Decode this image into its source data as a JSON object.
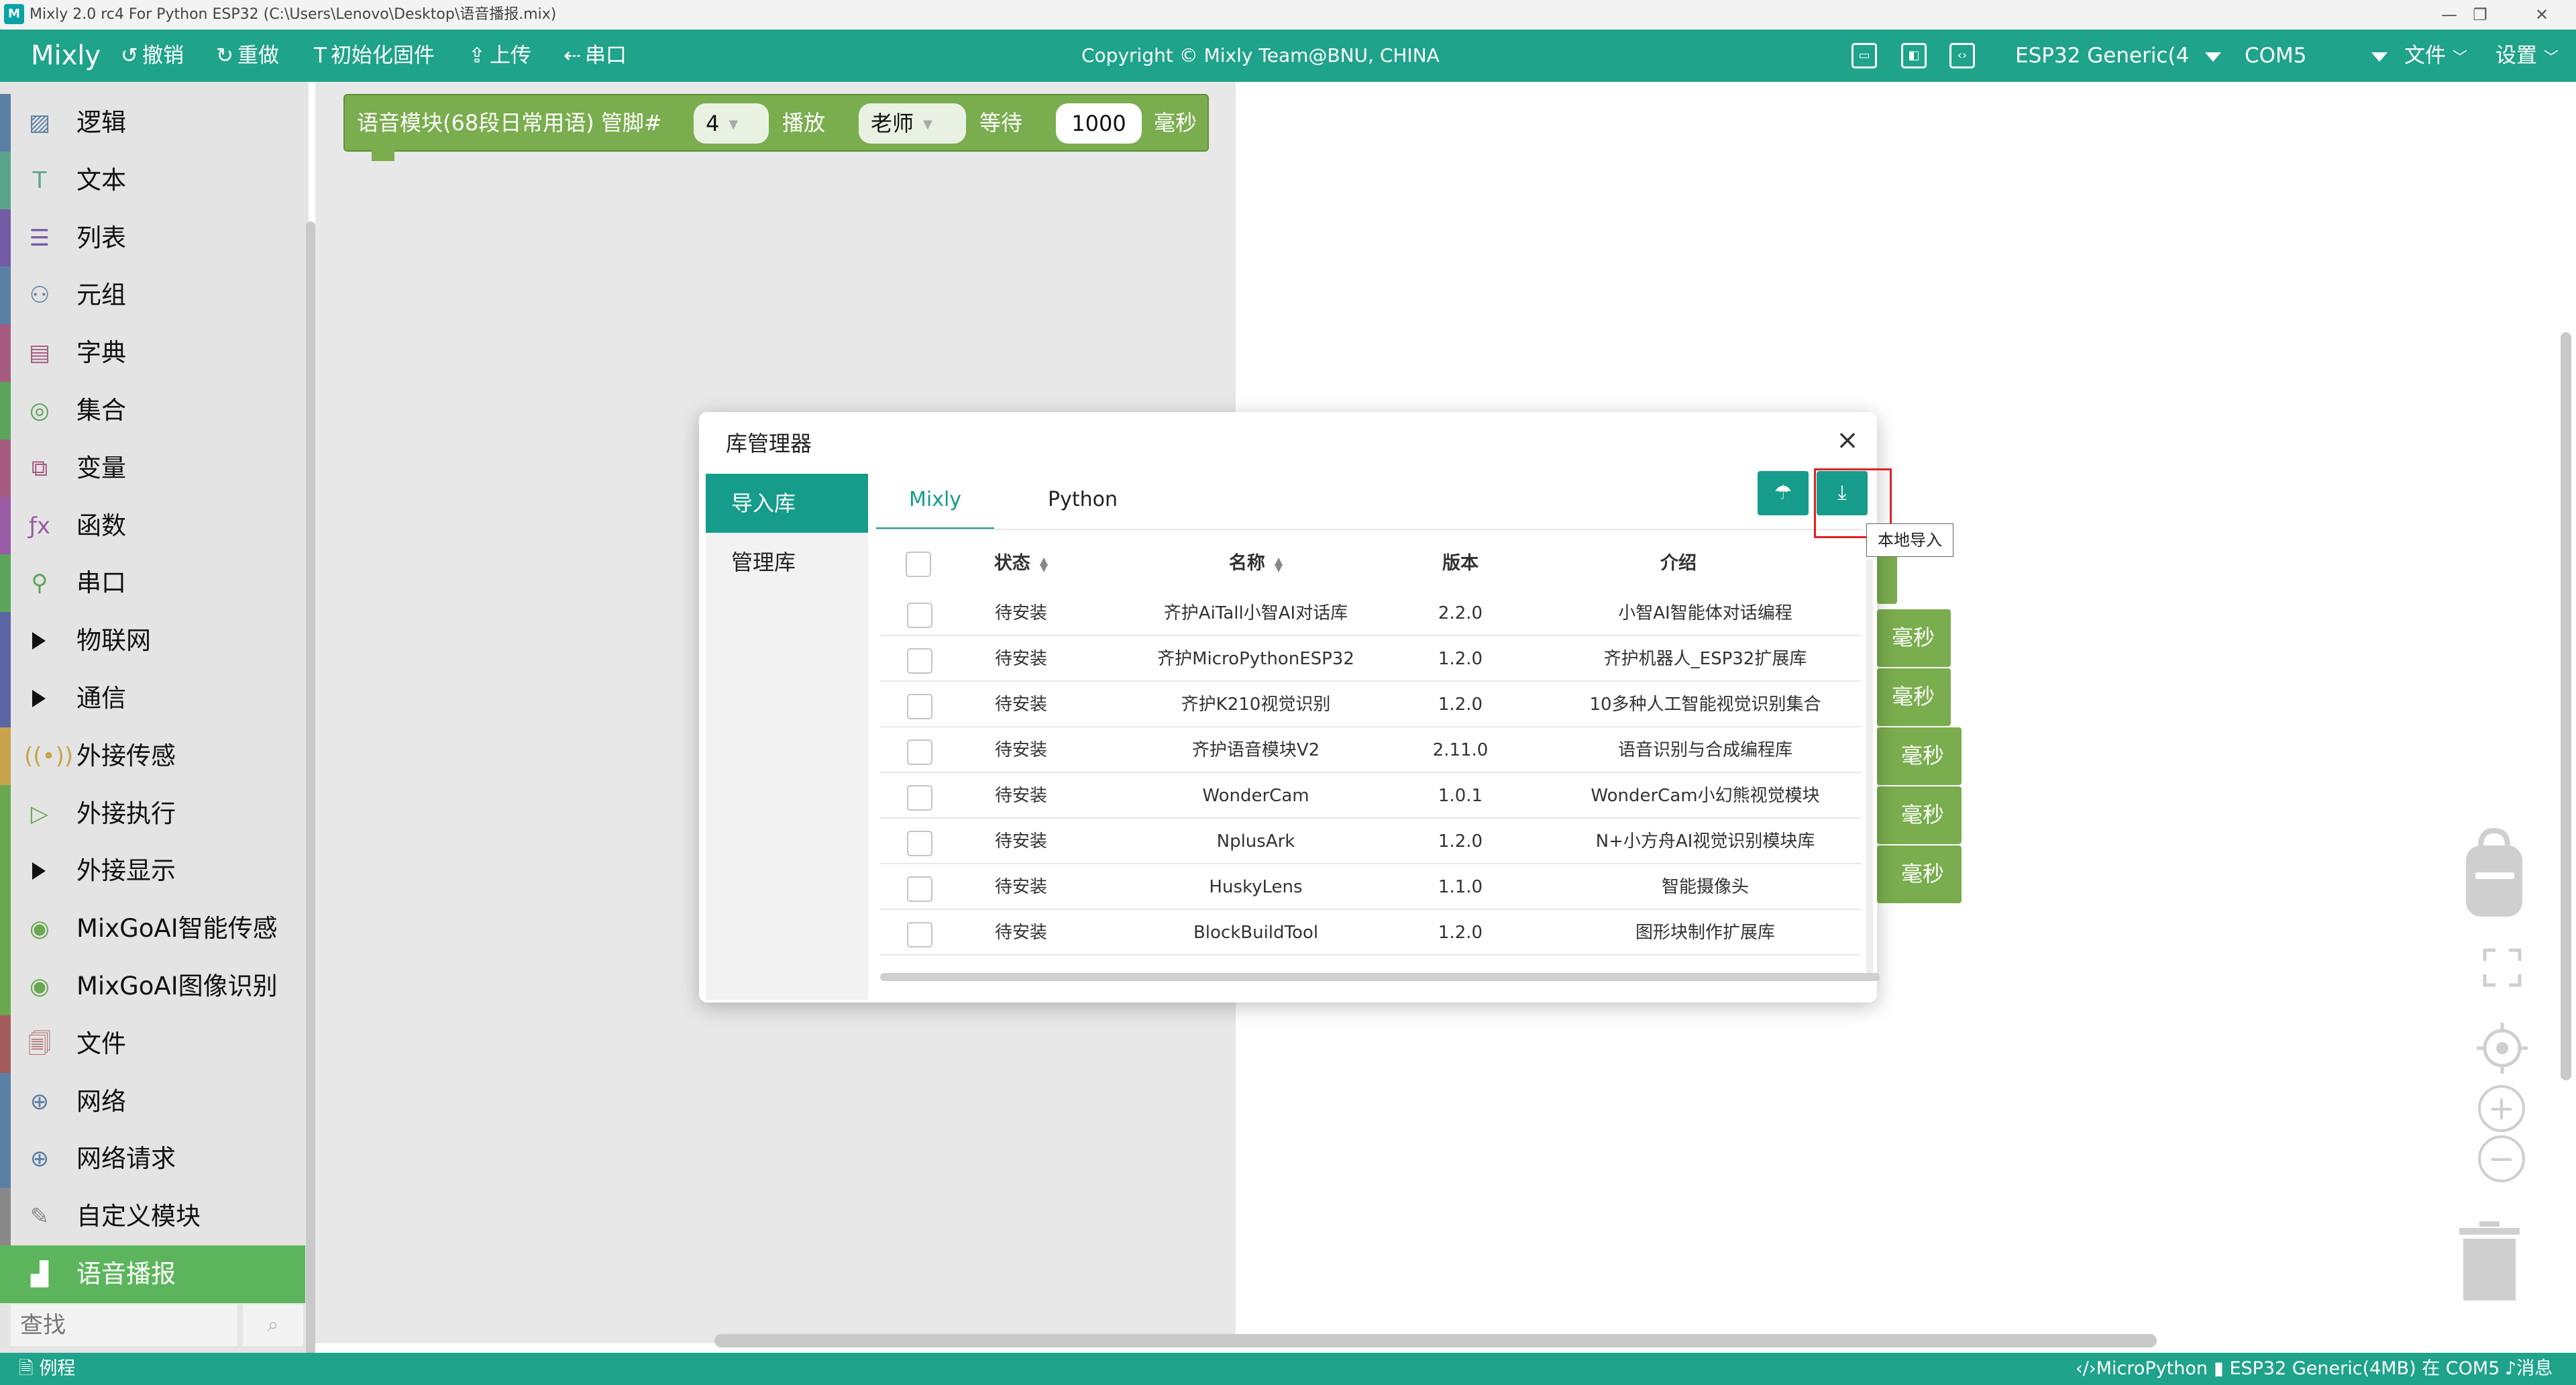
{
  "window": {
    "title": "Mixly 2.0 rc4 For Python ESP32 (C:\\Users\\Lenovo\\Desktop\\语音播报.mix)",
    "app_icon_text": "M",
    "minimize": "—",
    "restore": "❐",
    "close": "✕"
  },
  "toolbar": {
    "brand": "Mixly",
    "undo": "撤销",
    "redo": "重做",
    "init_firmware": "初始化固件",
    "upload": "上传",
    "serial": "串口",
    "copyright": "Copyright © Mixly Team@BNU, CHINA",
    "board": "ESP32 Generic(4",
    "port": "COM5",
    "file_menu": "文件",
    "settings_menu": "设置"
  },
  "sidebar": {
    "categories": [
      {
        "label": "逻辑",
        "icon": "logic-icon",
        "glyph": "▨",
        "color": "#5b80a5"
      },
      {
        "label": "文本",
        "icon": "text-icon",
        "glyph": "T",
        "color": "#5ba58c"
      },
      {
        "label": "列表",
        "icon": "list-icon",
        "glyph": "☰",
        "color": "#745ba5"
      },
      {
        "label": "元组",
        "icon": "tuple-icon",
        "glyph": "⚇",
        "color": "#5b80a5"
      },
      {
        "label": "字典",
        "icon": "dict-icon",
        "glyph": "▤",
        "color": "#a55b80"
      },
      {
        "label": "集合",
        "icon": "set-icon",
        "glyph": "◎",
        "color": "#5ba55b"
      },
      {
        "label": "变量",
        "icon": "variable-icon",
        "glyph": "⧉",
        "color": "#a55b80"
      },
      {
        "label": "函数",
        "icon": "function-icon",
        "glyph": "ƒx",
        "color": "#995ba5"
      },
      {
        "label": "串口",
        "icon": "serial-icon",
        "glyph": "⚲",
        "color": "#5ba55b"
      },
      {
        "label": "物联网",
        "icon": "triangle-icon",
        "glyph": "",
        "color": "#5b67a5",
        "expandable": true
      },
      {
        "label": "通信",
        "icon": "triangle-icon",
        "glyph": "",
        "color": "#5b67a5",
        "expandable": true
      },
      {
        "label": "外接传感",
        "icon": "sensor-icon",
        "glyph": "((•))",
        "color": "#c8a34a"
      },
      {
        "label": "外接执行",
        "icon": "actuator-icon",
        "glyph": "▷",
        "color": "#6aa84f"
      },
      {
        "label": "外接显示",
        "icon": "triangle-icon",
        "glyph": "",
        "color": "#6aa84f",
        "expandable": true
      },
      {
        "label": "MixGoAI智能传感",
        "icon": "eye-icon",
        "glyph": "◉",
        "color": "#6aa84f"
      },
      {
        "label": "MixGoAI图像识别",
        "icon": "eye-icon",
        "glyph": "◉",
        "color": "#6aa84f"
      },
      {
        "label": "文件",
        "icon": "file-icon",
        "glyph": "🗐",
        "color": "#a55b5b"
      },
      {
        "label": "网络",
        "icon": "globe-icon",
        "glyph": "⊕",
        "color": "#5b80a5"
      },
      {
        "label": "网络请求",
        "icon": "globe-icon",
        "glyph": "⊕",
        "color": "#5b80a5"
      },
      {
        "label": "自定义模块",
        "icon": "custom-icon",
        "glyph": "✎",
        "color": "#888888"
      },
      {
        "label": "语音播报",
        "icon": "module-icon",
        "glyph": "▟",
        "color": "#5cb55c",
        "selected": true
      }
    ],
    "search_placeholder": "查找"
  },
  "workspace": {
    "block": {
      "module": "语音模块(68段日常用语) 管脚#",
      "pin": "4",
      "play": "播放",
      "phrase": "老师",
      "wait": "等待",
      "duration": "1000",
      "unit": "毫秒"
    },
    "background_blocks": [
      "毫秒",
      "毫秒",
      "毫秒",
      "毫秒",
      "毫秒"
    ]
  },
  "modal": {
    "title": "库管理器",
    "side_items": [
      "导入库",
      "管理库"
    ],
    "tabs": [
      "Mixly",
      "Python"
    ],
    "tooltip": "本地导入",
    "columns": [
      "状态",
      "名称",
      "版本",
      "介绍"
    ],
    "rows": [
      {
        "status": "待安装",
        "name": "齐护AiTall小智AI对话库",
        "version": "2.2.0",
        "desc": "小智AI智能体对话编程"
      },
      {
        "status": "待安装",
        "name": "齐护MicroPythonESP32",
        "version": "1.2.0",
        "desc": "齐护机器人_ESP32扩展库"
      },
      {
        "status": "待安装",
        "name": "齐护K210视觉识别",
        "version": "1.2.0",
        "desc": "10多种人工智能视觉识别集合"
      },
      {
        "status": "待安装",
        "name": "齐护语音模块V2",
        "version": "2.11.0",
        "desc": "语音识别与合成编程库"
      },
      {
        "status": "待安装",
        "name": "WonderCam",
        "version": "1.0.1",
        "desc": "WonderCam小幻熊视觉模块"
      },
      {
        "status": "待安装",
        "name": "NplusArk",
        "version": "1.2.0",
        "desc": "N+小方舟AI视觉识别模块库"
      },
      {
        "status": "待安装",
        "name": "HuskyLens",
        "version": "1.1.0",
        "desc": "智能摄像头"
      },
      {
        "status": "待安装",
        "name": "BlockBuildTool",
        "version": "1.2.0",
        "desc": "图形块制作扩展库"
      }
    ]
  },
  "statusbar": {
    "examples": "例程",
    "language": "MicroPython",
    "board_status": "ESP32 Generic(4MB) 在 COM5",
    "messages": "消息"
  },
  "colors": {
    "accent": "#1fa38a",
    "modal_accent": "#159c8b",
    "block_green": "#7aad4e",
    "highlight_red": "#e02020"
  }
}
